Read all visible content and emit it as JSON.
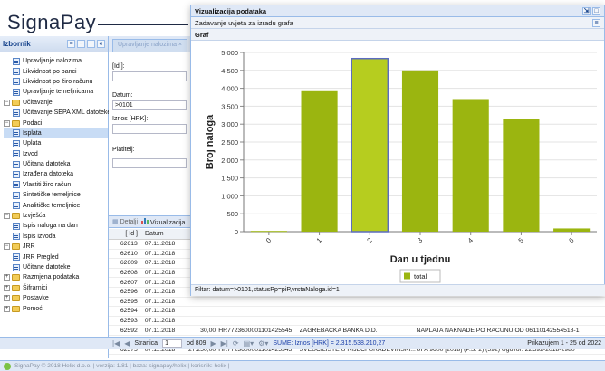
{
  "app": {
    "logo": "SignaPay"
  },
  "sidebar": {
    "title": "Izbornik",
    "tools": [
      "≡",
      "−",
      "+",
      "«"
    ],
    "items": [
      {
        "label": "Upravljanje nalozima",
        "level": 1,
        "icon": "leaf"
      },
      {
        "label": "Likvidnost po banci",
        "level": 1,
        "icon": "leaf"
      },
      {
        "label": "Likvidnost po žiro računu",
        "level": 1,
        "icon": "leaf"
      },
      {
        "label": "Upravljanje temeljnicama",
        "level": 1,
        "icon": "leaf"
      },
      {
        "label": "Učitavanje",
        "level": 0,
        "icon": "folder",
        "expander": "−"
      },
      {
        "label": "Učitavanje SEPA XML datoteke",
        "level": 1,
        "icon": "leaf"
      },
      {
        "label": "Podaci",
        "level": 0,
        "icon": "folder",
        "expander": "−"
      },
      {
        "label": "Isplata",
        "level": 1,
        "icon": "leaf",
        "selected": true
      },
      {
        "label": "Uplata",
        "level": 1,
        "icon": "leaf"
      },
      {
        "label": "Izvod",
        "level": 1,
        "icon": "leaf"
      },
      {
        "label": "Učitana datoteka",
        "level": 1,
        "icon": "leaf"
      },
      {
        "label": "Izrađena datoteka",
        "level": 1,
        "icon": "leaf"
      },
      {
        "label": "Vlastiti žiro račun",
        "level": 1,
        "icon": "leaf"
      },
      {
        "label": "Sintetičke temeljnice",
        "level": 1,
        "icon": "leaf"
      },
      {
        "label": "Analitičke temeljnice",
        "level": 1,
        "icon": "leaf"
      },
      {
        "label": "Izvješća",
        "level": 0,
        "icon": "folder",
        "expander": "−"
      },
      {
        "label": "Ispis naloga na dan",
        "level": 1,
        "icon": "leaf"
      },
      {
        "label": "Ispis izvoda",
        "level": 1,
        "icon": "leaf"
      },
      {
        "label": "JRR",
        "level": 0,
        "icon": "folder",
        "expander": "−"
      },
      {
        "label": "JRR Pregled",
        "level": 1,
        "icon": "leaf"
      },
      {
        "label": "Učitane datoteke",
        "level": 1,
        "icon": "leaf"
      },
      {
        "label": "Razmjena podataka",
        "level": 0,
        "icon": "folder",
        "expander": "+"
      },
      {
        "label": "Šifrarnici",
        "level": 0,
        "icon": "folder",
        "expander": "+"
      },
      {
        "label": "Postavke",
        "level": 0,
        "icon": "folder",
        "expander": "+"
      },
      {
        "label": "Pomoć",
        "level": 0,
        "icon": "folder",
        "expander": "+"
      }
    ]
  },
  "main": {
    "tab_label": "Upravljanje nalozima ×",
    "form": {
      "id_label": "[Id ]:",
      "id_value": "",
      "datum_label": "Datum:",
      "datum_value": ">0101",
      "iznos_label": "Iznos [HRK]:",
      "iznos_value": "",
      "platitelj_label": "Platitelj:",
      "platitelj_value": ""
    },
    "grid_toolbar": {
      "detalji": "Detalji",
      "vizualizacija": "Vizualizacija"
    },
    "grid": {
      "headers": [
        "[ Id ]",
        "Datum",
        "I"
      ],
      "rows": [
        {
          "id": "62613",
          "date": "07.11.2018",
          "amount": "",
          "iban": "",
          "name": "",
          "desc": "",
          "ref": ""
        },
        {
          "id": "62610",
          "date": "07.11.2018",
          "amount": "",
          "iban": "",
          "name": "",
          "desc": "",
          "ref": ""
        },
        {
          "id": "62609",
          "date": "07.11.2018",
          "amount": "",
          "iban": "",
          "name": "",
          "desc": "",
          "ref": ""
        },
        {
          "id": "62608",
          "date": "07.11.2018",
          "amount": "",
          "iban": "",
          "name": "",
          "desc": "",
          "ref": ""
        },
        {
          "id": "62607",
          "date": "07.11.2018",
          "amount": "",
          "iban": "",
          "name": "",
          "desc": "",
          "ref": ""
        },
        {
          "id": "62596",
          "date": "07.11.2018",
          "amount": "",
          "iban": "",
          "name": "",
          "desc": "",
          "ref": ""
        },
        {
          "id": "62595",
          "date": "07.11.2018",
          "amount": "",
          "iban": "",
          "name": "",
          "desc": "",
          "ref": ""
        },
        {
          "id": "62594",
          "date": "07.11.2018",
          "amount": "",
          "iban": "",
          "name": "",
          "desc": "",
          "ref": ""
        },
        {
          "id": "62593",
          "date": "07.11.2018",
          "amount": "",
          "iban": "",
          "name": "",
          "desc": "",
          "ref": ""
        },
        {
          "id": "62592",
          "date": "07.11.2018",
          "amount": "30,00",
          "iban": "HR7723600001101425545",
          "name": "ZAGREBAČKA BANKA D.D.",
          "desc": "NAPLATA NAKNADE PO RAČUNU OD 06....",
          "ref": "110142554518-1"
        },
        {
          "id": "62576",
          "date": "07.11.2018",
          "amount": "47.037,50",
          "iban": "HR7723600001101425545",
          "name": "DRŽAVNI PRORAČUN REPUBLIKE HRV...",
          "desc": "UFA 9601 [2018] (P.S. 2) (18/720) Ugovor: 3...",
          "ref": "7129-051-21609"
        },
        {
          "id": "62575",
          "date": "07.11.2018",
          "amount": "27.250,00",
          "iban": "HR7723600001101425545",
          "name": "SVEUČILIŠTE U RIJECI GRAĐEVINSKI...",
          "desc": "UFA 9600 [2018] (P.S. 2) (592) Ugovor: 225-...",
          "ref": "592-2018-2980"
        }
      ]
    }
  },
  "pager": {
    "page_label": "Stranica",
    "page_value": "1",
    "of_label": "od 809",
    "sum_text": "SUME: Iznos [HRK] = 2.315.538.210,27",
    "display_text": "Prikazujem 1 - 25 od 2022"
  },
  "statusbar": {
    "text": "SignaPay © 2018 Helix d.o.o. | verzija: 1.81 | baza: signapay/helix | korisnik: helix |"
  },
  "modal": {
    "title": "Vizualizacija podataka",
    "subtitle": "Zadavanje uvjeta za izradu grafa",
    "graf_label": "Graf",
    "filter_text": "Filtar: datum=>0101,statusPp=piP,vrstaNaloga.id=1"
  },
  "colors": {
    "bar": "#9bb510",
    "bar_highlight": "#b6cd1f",
    "highlight_border": "#5b6bc0",
    "header_bg": "#dfe8f6"
  },
  "chart_data": {
    "type": "bar",
    "categories": [
      "0",
      "1",
      "2",
      "3",
      "4",
      "5",
      "6"
    ],
    "series": [
      {
        "name": "total",
        "values": [
          20,
          3920,
          4830,
          4500,
          3700,
          3150,
          90
        ]
      }
    ],
    "highlighted_index": 2,
    "xlabel": "Dan u tjednu",
    "ylabel": "Broj naloga",
    "ylim": [
      0,
      5000
    ],
    "yticks": [
      "0",
      "500",
      "1.000",
      "1.500",
      "2.000",
      "2.500",
      "3.000",
      "3.500",
      "4.000",
      "4.500",
      "5.000"
    ],
    "grid": true,
    "legend": "bottom"
  }
}
